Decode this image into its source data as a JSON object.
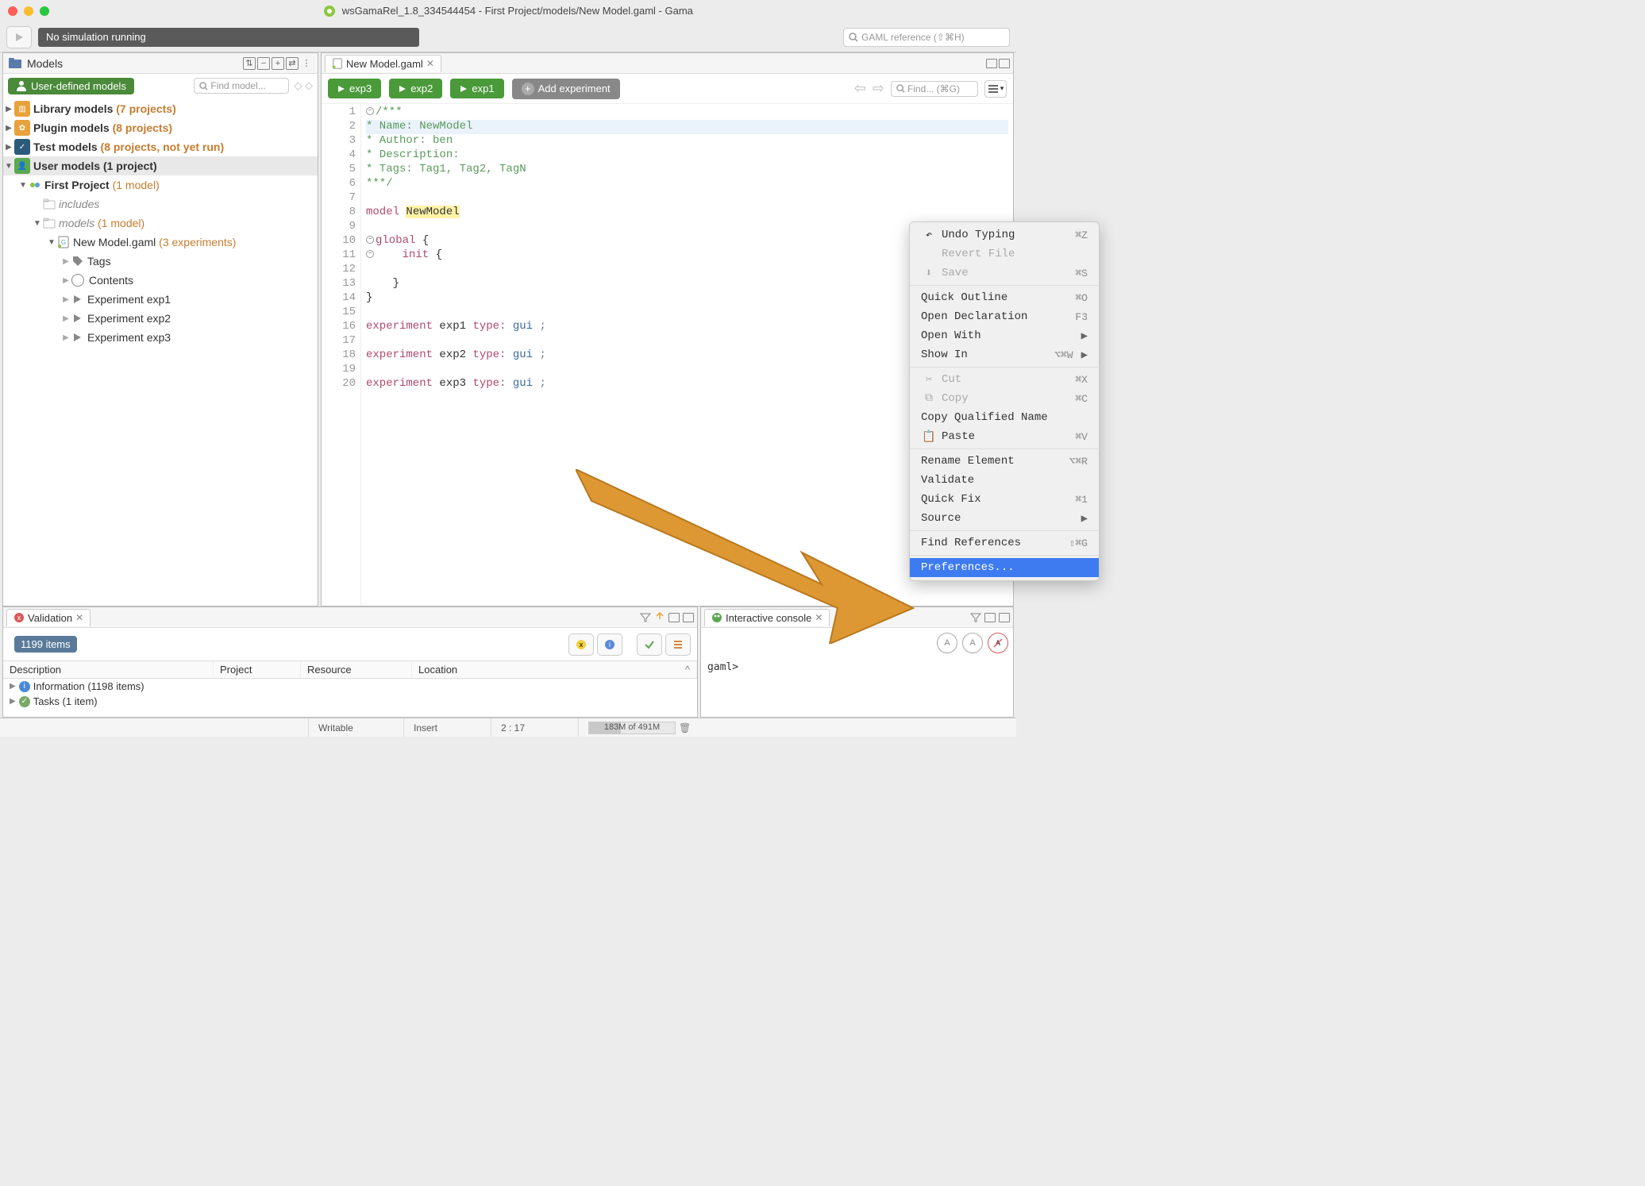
{
  "window": {
    "title": "wsGamaRel_1.8_334544454 - First Project/models/New Model.gaml - Gama"
  },
  "toolbar": {
    "sim_status": "No simulation running",
    "search_placeholder": "GAML reference (⇧⌘H)"
  },
  "sidebar": {
    "title": "Models",
    "badge": "User-defined models",
    "find_placeholder": "Find model...",
    "groups": {
      "library": {
        "label": "Library models",
        "count": "(7 projects)"
      },
      "plugin": {
        "label": "Plugin models",
        "count": "(8 projects)"
      },
      "test": {
        "label": "Test models",
        "count": "(8 projects, not yet run)"
      },
      "user": {
        "label": "User models",
        "count": "(1 project)"
      }
    },
    "project": {
      "name": "First Project",
      "count": "(1 model)",
      "includes": "includes",
      "models_label": "models",
      "models_count": "(1 model)",
      "file": {
        "name": "New Model.gaml",
        "count": "(3 experiments)",
        "children": {
          "tags": "Tags",
          "contents": "Contents",
          "exp1": "Experiment exp1",
          "exp2": "Experiment exp2",
          "exp3": "Experiment exp3"
        }
      }
    }
  },
  "editor": {
    "tab_name": "New Model.gaml",
    "exp_buttons": {
      "b1": "exp3",
      "b2": "exp2",
      "b3": "exp1"
    },
    "add_experiment": "Add experiment",
    "find_placeholder": "Find... (⌘G)",
    "lines": {
      "l1": "/***",
      "l2": "* Name: NewModel",
      "l3": "* Author: ben",
      "l4": "* Description:",
      "l5": "* Tags: Tag1, Tag2, TagN",
      "l6": "***/",
      "l8a": "model ",
      "l8b": "NewModel",
      "l10a": "global",
      "l10b": " {",
      "l11a": "    init",
      "l11b": " {",
      "l13": "    }",
      "l14": "}",
      "l16a": "experiment",
      "l16b": " exp1 ",
      "l16c": "type:",
      "l16d": " gui",
      "l16e": " ;",
      "l18a": "experiment",
      "l18b": " exp2 ",
      "l18c": "type:",
      "l18d": " gui",
      "l18e": " ;",
      "l20a": "experiment",
      "l20b": " exp3 ",
      "l20c": "type:",
      "l20d": " gui",
      "l20e": " ;"
    }
  },
  "context_menu": {
    "undo": "Undo Typing",
    "undo_sc": "⌘Z",
    "revert": "Revert File",
    "save": "Save",
    "save_sc": "⌘S",
    "quick_outline": "Quick Outline",
    "quick_outline_sc": "⌘O",
    "open_decl": "Open Declaration",
    "open_decl_sc": "F3",
    "open_with": "Open With",
    "show_in": "Show In",
    "show_in_sc": "⌥⌘W",
    "cut": "Cut",
    "cut_sc": "⌘X",
    "copy": "Copy",
    "copy_sc": "⌘C",
    "copy_qn": "Copy Qualified Name",
    "paste": "Paste",
    "paste_sc": "⌘V",
    "rename": "Rename Element",
    "rename_sc": "⌥⌘R",
    "validate": "Validate",
    "quick_fix": "Quick Fix",
    "quick_fix_sc": "⌘1",
    "source": "Source",
    "find_ref": "Find References",
    "find_ref_sc": "⇧⌘G",
    "prefs": "Preferences..."
  },
  "validation": {
    "tab": "Validation",
    "items": "1199 items",
    "cols": {
      "desc": "Description",
      "proj": "Project",
      "res": "Resource",
      "loc": "Location"
    },
    "rows": {
      "info": "Information (1198 items)",
      "tasks": "Tasks (1 item)"
    }
  },
  "console": {
    "tab": "Interactive console",
    "prompt": "gaml>"
  },
  "statusbar": {
    "writable": "Writable",
    "insert": "Insert",
    "pos": "2 : 17",
    "heap": "183M of 491M"
  }
}
